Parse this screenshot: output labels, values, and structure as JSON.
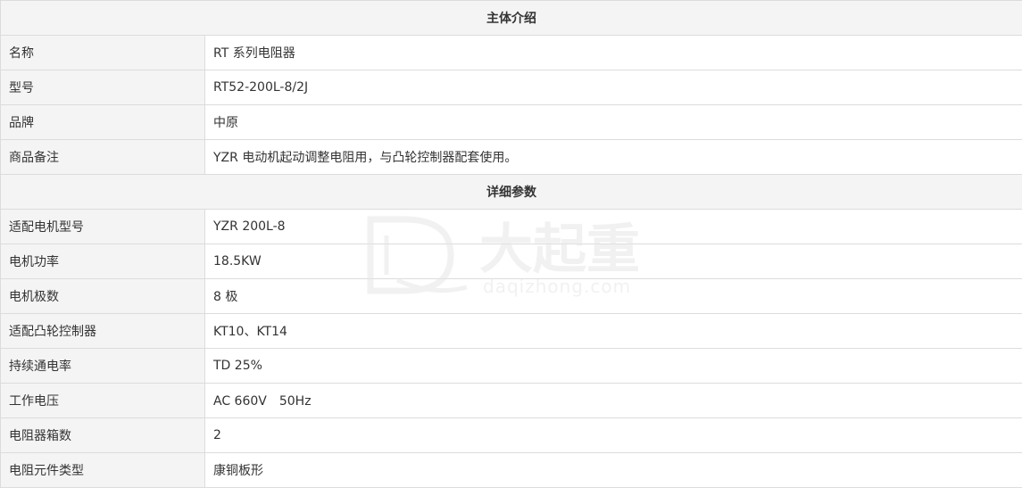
{
  "sections": [
    {
      "title": "主体介绍",
      "rows": [
        {
          "label": "名称",
          "value": "RT 系列电阻器"
        },
        {
          "label": "型号",
          "value": "RT52-200L-8/2J"
        },
        {
          "label": "品牌",
          "value": "中原"
        },
        {
          "label": "商品备注",
          "value": "YZR 电动机起动调整电阻用，与凸轮控制器配套使用。"
        }
      ]
    },
    {
      "title": "详细参数",
      "rows": [
        {
          "label": "适配电机型号",
          "value": "YZR 200L-8"
        },
        {
          "label": "电机功率",
          "value": "18.5KW"
        },
        {
          "label": "电机极数",
          "value": "8 极"
        },
        {
          "label": "适配凸轮控制器",
          "value": "KT10、KT14"
        },
        {
          "label": "持续通电率",
          "value": "TD 25%"
        },
        {
          "label": "工作电压",
          "value": "AC 660V　50Hz"
        },
        {
          "label": "电阻器箱数",
          "value": "2"
        },
        {
          "label": "电阻元件类型",
          "value": "康铜板形"
        }
      ]
    }
  ],
  "watermark": {
    "brand_cn": "大起重",
    "brand_domain": "daqizhong.com",
    "color": "#e6e6e6"
  }
}
